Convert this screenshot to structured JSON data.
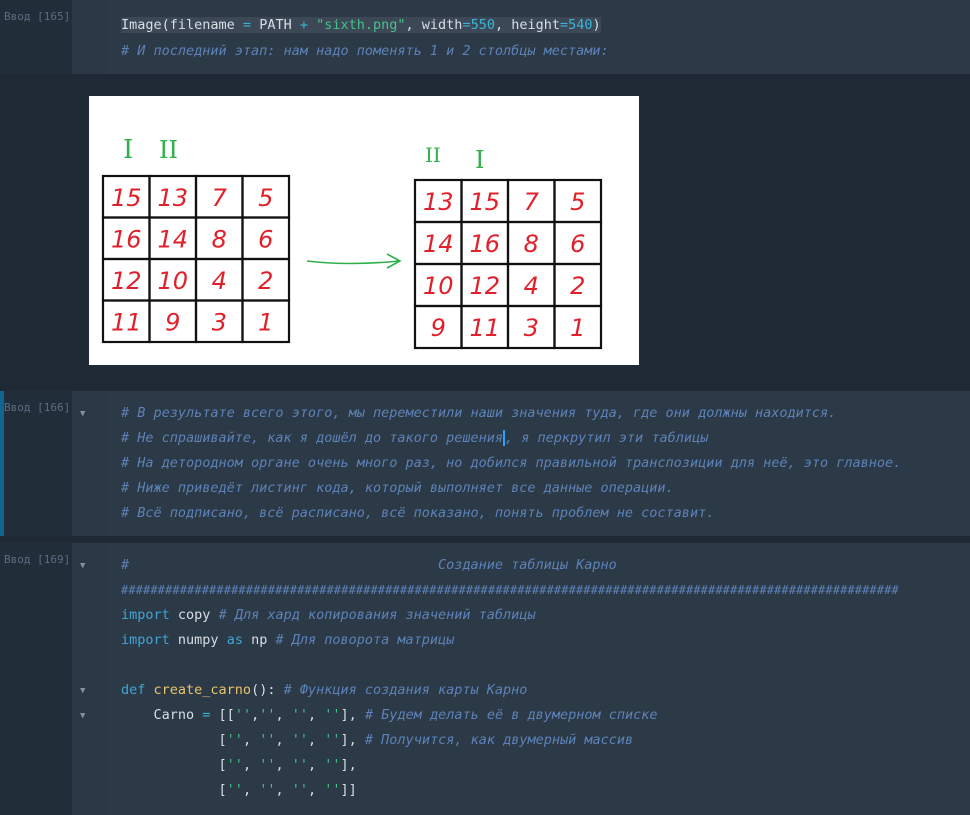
{
  "cells": [
    {
      "prompt": "Ввод [165]",
      "lines": [
        {
          "parts": [
            [
              "txt",
              "Image(filename "
            ],
            [
              "op",
              "="
            ],
            [
              "txt",
              " PATH "
            ],
            [
              "op",
              "+"
            ],
            [
              "txt",
              " "
            ],
            [
              "st",
              "\"sixth.png\""
            ],
            [
              "txt",
              ", width"
            ],
            [
              "op",
              "="
            ],
            [
              "num",
              "550"
            ],
            [
              "txt",
              ", height"
            ],
            [
              "op",
              "="
            ],
            [
              "num",
              "540"
            ],
            [
              "txt",
              ")"
            ]
          ]
        },
        {
          "parts": [
            [
              "cm",
              "# И последний этап: нам надо поменять 1 и 2 столбцы местами:"
            ]
          ]
        }
      ]
    },
    {
      "prompt": "Ввод [166]",
      "lines": [
        {
          "parts": [
            [
              "cm",
              "# В результате всего этого, мы переместили наши значения туда, где они должны находится."
            ]
          ]
        },
        {
          "parts": [
            [
              "cm",
              "# Не спрашивайте, как я дошёл до такого решения"
            ],
            [
              "cursor",
              ""
            ],
            [
              "cm",
              ", я перкрутил эти таблицы"
            ]
          ]
        },
        {
          "parts": [
            [
              "cm",
              "# На детородном органе очень много раз, но добился правильной транспозиции для неё, это главное."
            ]
          ]
        },
        {
          "parts": [
            [
              "cm",
              "# Ниже приведёт листинг кода, который выполняет все данные операции."
            ]
          ]
        },
        {
          "parts": [
            [
              "cm",
              "# Всё подписано, всё расписано, всё показано, понять проблем не составит."
            ]
          ]
        }
      ]
    },
    {
      "prompt": "Ввод [169]",
      "lines": [
        {
          "parts": [
            [
              "cm",
              "#                                      Создание таблицы Карно"
            ]
          ]
        },
        {
          "parts": [
            [
              "cm",
              "##########################################################################################################"
            ]
          ]
        },
        {
          "parts": [
            [
              "kw",
              "import"
            ],
            [
              "txt",
              " copy "
            ],
            [
              "cm",
              "# Для хард копирования значений таблицы"
            ]
          ]
        },
        {
          "parts": [
            [
              "kw",
              "import"
            ],
            [
              "txt",
              " numpy "
            ],
            [
              "kw",
              "as"
            ],
            [
              "txt",
              " np "
            ],
            [
              "cm",
              "# Для поворота матрицы"
            ]
          ]
        },
        {
          "parts": []
        },
        {
          "parts": [
            [
              "kw",
              "def"
            ],
            [
              "txt",
              " "
            ],
            [
              "fn",
              "create_carno"
            ],
            [
              "txt",
              "(): "
            ],
            [
              "cm",
              "# Функция создания карты Карно"
            ]
          ]
        },
        {
          "parts": [
            [
              "txt",
              "    Carno "
            ],
            [
              "op",
              "="
            ],
            [
              "txt",
              " [["
            ],
            [
              "st",
              "''"
            ],
            [
              "txt",
              ","
            ],
            [
              "st",
              "''"
            ],
            [
              "txt",
              ", "
            ],
            [
              "st",
              "''"
            ],
            [
              "txt",
              ", "
            ],
            [
              "st",
              "''"
            ],
            [
              "txt",
              "], "
            ],
            [
              "cm",
              "# Будем делать её в двумерном списке"
            ]
          ]
        },
        {
          "parts": [
            [
              "txt",
              "            ["
            ],
            [
              "st",
              "''"
            ],
            [
              "txt",
              ", "
            ],
            [
              "st",
              "''"
            ],
            [
              "txt",
              ", "
            ],
            [
              "st",
              "''"
            ],
            [
              "txt",
              ", "
            ],
            [
              "st",
              "''"
            ],
            [
              "txt",
              "], "
            ],
            [
              "cm",
              "# Получится, как двумерный массив"
            ]
          ]
        },
        {
          "parts": [
            [
              "txt",
              "            ["
            ],
            [
              "st",
              "''"
            ],
            [
              "txt",
              ", "
            ],
            [
              "st",
              "''"
            ],
            [
              "txt",
              ", "
            ],
            [
              "st",
              "''"
            ],
            [
              "txt",
              ", "
            ],
            [
              "st",
              "''"
            ],
            [
              "txt",
              "],"
            ]
          ]
        },
        {
          "parts": [
            [
              "txt",
              "            ["
            ],
            [
              "st",
              "''"
            ],
            [
              "txt",
              ", "
            ],
            [
              "st",
              "''"
            ],
            [
              "txt",
              ", "
            ],
            [
              "st",
              "''"
            ],
            [
              "txt",
              ", "
            ],
            [
              "st",
              "''"
            ],
            [
              "txt",
              "]]"
            ]
          ]
        }
      ]
    }
  ],
  "image": {
    "left_headers": [
      "I",
      "II"
    ],
    "right_headers": [
      "II",
      "I"
    ],
    "left_grid": [
      [
        "15",
        "13",
        "7",
        "5"
      ],
      [
        "16",
        "14",
        "8",
        "6"
      ],
      [
        "12",
        "10",
        "4",
        "2"
      ],
      [
        "11",
        "9",
        "3",
        "1"
      ]
    ],
    "right_grid": [
      [
        "13",
        "15",
        "7",
        "5"
      ],
      [
        "14",
        "16",
        "8",
        "6"
      ],
      [
        "10",
        "12",
        "4",
        "2"
      ],
      [
        "9",
        "11",
        "3",
        "1"
      ]
    ],
    "colors": {
      "digits": "#e0202a",
      "headers": "#2fb04a",
      "arrow": "#2fb04a",
      "grid": "#111111"
    }
  }
}
